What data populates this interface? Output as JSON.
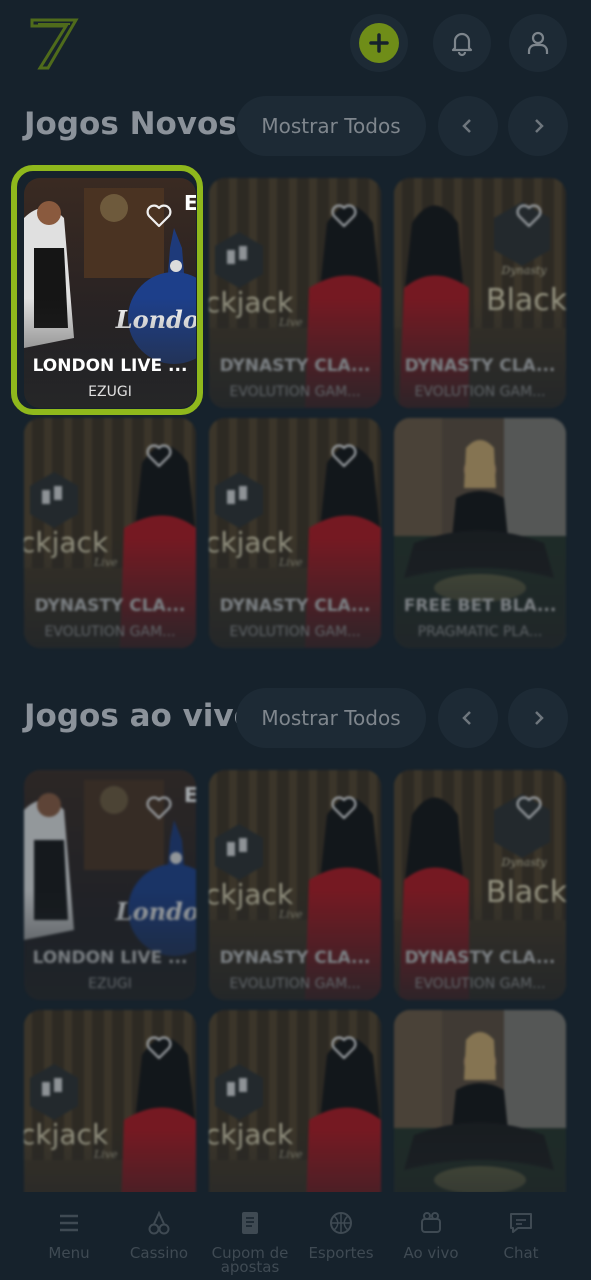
{
  "header": {
    "logo_text": "7",
    "add_button_icon": "plus-icon",
    "notifications_icon": "bell-icon",
    "profile_icon": "user-icon"
  },
  "sections": [
    {
      "title": "Jogos Novos",
      "show_all_label": "Mostrar Todos",
      "cards": [
        {
          "title": "LONDON LIVE ...",
          "provider": "EZUGI",
          "theme": "london"
        },
        {
          "title": "DYNASTY CLA...",
          "provider": "EVOLUTION GAM...",
          "theme": "dynasty"
        },
        {
          "title": "DYNASTY CLA...",
          "provider": "EVOLUTION GAM...",
          "theme": "dynasty-black"
        },
        {
          "title": "DYNASTY CLA...",
          "provider": "EVOLUTION GAM...",
          "theme": "dynasty"
        },
        {
          "title": "DYNASTY CLA...",
          "provider": "EVOLUTION GAM...",
          "theme": "dynasty"
        },
        {
          "title": "FREE BET BLA...",
          "provider": "PRAGMATIC PLA...",
          "theme": "freebet"
        }
      ]
    },
    {
      "title": "Jogos ao vivo",
      "show_all_label": "Mostrar Todos",
      "cards": [
        {
          "title": "LONDON LIVE ...",
          "provider": "EZUGI",
          "theme": "london"
        },
        {
          "title": "DYNASTY CLA...",
          "provider": "EVOLUTION GAM...",
          "theme": "dynasty"
        },
        {
          "title": "DYNASTY CLA...",
          "provider": "EVOLUTION GAM...",
          "theme": "dynasty-black"
        },
        {
          "title": "",
          "provider": "",
          "theme": "dynasty"
        },
        {
          "title": "",
          "provider": "",
          "theme": "dynasty"
        },
        {
          "title": "",
          "provider": "",
          "theme": "freebet"
        }
      ]
    }
  ],
  "card_art_text": {
    "london": "London",
    "blackjack": "ckjack",
    "live": "Live",
    "black": "Black",
    "dynasty": "Dynasty",
    "e": "E"
  },
  "bottom_nav": [
    {
      "label": "Menu",
      "icon": "menu-icon"
    },
    {
      "label": "Cassino",
      "icon": "cherries-icon"
    },
    {
      "label": "Cupom de apostas",
      "icon": "ticket-icon"
    },
    {
      "label": "Esportes",
      "icon": "basketball-icon"
    },
    {
      "label": "Ao vivo",
      "icon": "live-icon"
    },
    {
      "label": "Chat",
      "icon": "chat-icon"
    }
  ],
  "colors": {
    "background": "#16222c",
    "accent": "#8fb81c",
    "button_bg": "#1d2a35"
  }
}
